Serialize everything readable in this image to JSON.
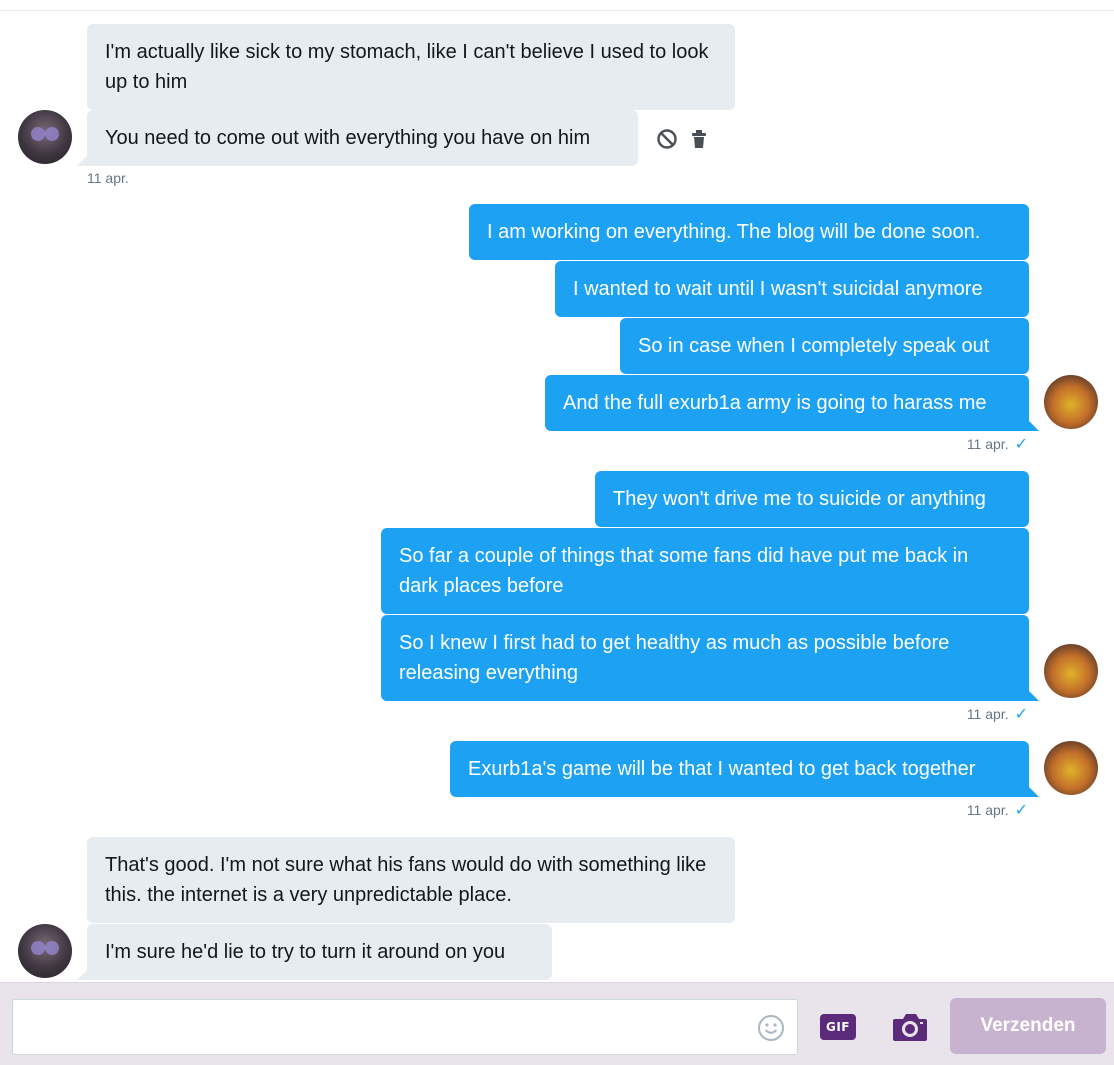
{
  "messages": [
    {
      "side": "received",
      "text": "I'm actually like sick to my stomach, like I can't believe I used to look up to him"
    },
    {
      "side": "received",
      "text": "You need to come out with everything you have on him"
    },
    {
      "side": "sent",
      "text": "I am working on everything. The blog will be done soon."
    },
    {
      "side": "sent",
      "text": "I wanted to wait until I wasn't suicidal anymore"
    },
    {
      "side": "sent",
      "text": "So in case when I completely speak out"
    },
    {
      "side": "sent",
      "text": "And the full exurb1a army is going to harass me"
    },
    {
      "side": "sent",
      "text": "They won't drive me to suicide or anything"
    },
    {
      "side": "sent",
      "text": "So far a couple of things that some fans did have put me back in dark places before"
    },
    {
      "side": "sent",
      "text": "So I knew I first had to get healthy as much as possible before releasing everything"
    },
    {
      "side": "sent",
      "text": "Exurb1a's game will be that I wanted to get back together"
    },
    {
      "side": "received",
      "text": "That's good. I'm not sure what his fans would do with something like this. the internet is a very unpredictable place."
    },
    {
      "side": "received",
      "text": "I'm sure he'd lie to try to turn it around on you"
    }
  ],
  "timestamps": {
    "t1": "11 apr.",
    "t2": "11 apr.",
    "t3": "11 apr.",
    "t4": "11 apr."
  },
  "read_mark": "✓",
  "composer": {
    "placeholder": "",
    "gif_label": "GIF",
    "send_label": "Verzenden"
  },
  "icons": {
    "block": "block-icon",
    "delete": "trash-icon",
    "emoji": "emoji-icon",
    "gif": "gif-icon",
    "camera": "camera-icon"
  },
  "colors": {
    "sent_bubble": "#1da1f2",
    "received_bubble": "#e6ecf0",
    "send_button_disabled": "#c7b3cf",
    "composer_bg": "#e9e3ec",
    "accent_purple": "#5c2a7a"
  }
}
